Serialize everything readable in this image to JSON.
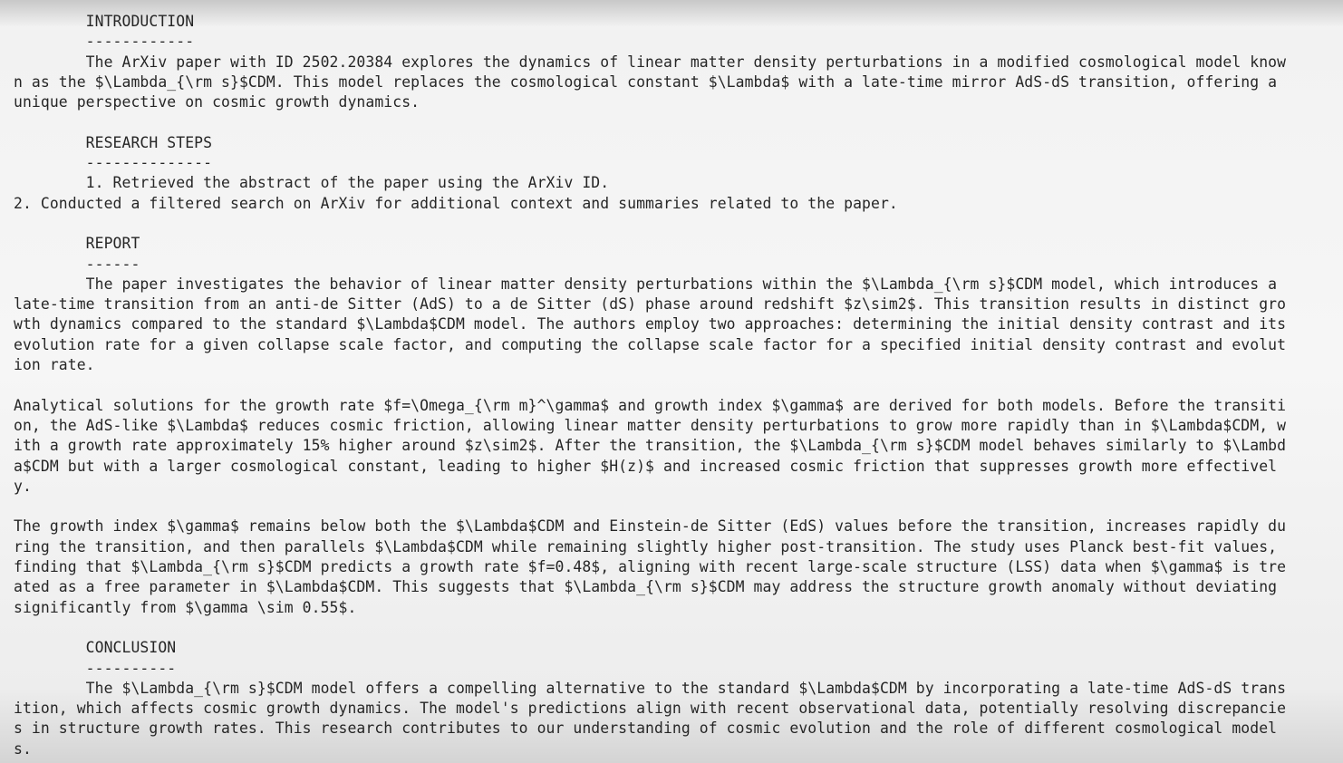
{
  "document": {
    "lines": [
      "        INTRODUCTION",
      "        ------------",
      "        The ArXiv paper with ID 2502.20384 explores the dynamics of linear matter density perturbations in a modified cosmological model know",
      "n as the $\\Lambda_{\\rm s}$CDM. This model replaces the cosmological constant $\\Lambda$ with a late-time mirror AdS-dS transition, offering a",
      "unique perspective on cosmic growth dynamics.",
      "",
      "        RESEARCH STEPS",
      "        --------------",
      "        1. Retrieved the abstract of the paper using the ArXiv ID.",
      "2. Conducted a filtered search on ArXiv for additional context and summaries related to the paper.",
      "",
      "        REPORT",
      "        ------",
      "        The paper investigates the behavior of linear matter density perturbations within the $\\Lambda_{\\rm s}$CDM model, which introduces a",
      "late-time transition from an anti-de Sitter (AdS) to a de Sitter (dS) phase around redshift $z\\sim2$. This transition results in distinct gro",
      "wth dynamics compared to the standard $\\Lambda$CDM model. The authors employ two approaches: determining the initial density contrast and its",
      "evolution rate for a given collapse scale factor, and computing the collapse scale factor for a specified initial density contrast and evolut",
      "ion rate.",
      "",
      "Analytical solutions for the growth rate $f=\\Omega_{\\rm m}^\\gamma$ and growth index $\\gamma$ are derived for both models. Before the transiti",
      "on, the AdS-like $\\Lambda$ reduces cosmic friction, allowing linear matter density perturbations to grow more rapidly than in $\\Lambda$CDM, w",
      "ith a growth rate approximately 15% higher around $z\\sim2$. After the transition, the $\\Lambda_{\\rm s}$CDM model behaves similarly to $\\Lambd",
      "a$CDM but with a larger cosmological constant, leading to higher $H(z)$ and increased cosmic friction that suppresses growth more effectivel",
      "y.",
      "",
      "The growth index $\\gamma$ remains below both the $\\Lambda$CDM and Einstein-de Sitter (EdS) values before the transition, increases rapidly du",
      "ring the transition, and then parallels $\\Lambda$CDM while remaining slightly higher post-transition. The study uses Planck best-fit values,",
      "finding that $\\Lambda_{\\rm s}$CDM predicts a growth rate $f=0.48$, aligning with recent large-scale structure (LSS) data when $\\gamma$ is tre",
      "ated as a free parameter in $\\Lambda$CDM. This suggests that $\\Lambda_{\\rm s}$CDM may address the structure growth anomaly without deviating",
      "significantly from $\\gamma \\sim 0.55$.",
      "",
      "        CONCLUSION",
      "        ----------",
      "        The $\\Lambda_{\\rm s}$CDM model offers a compelling alternative to the standard $\\Lambda$CDM by incorporating a late-time AdS-dS trans",
      "ition, which affects cosmic growth dynamics. The model's predictions align with recent observational data, potentially resolving discrepancie",
      "s in structure growth rates. This research contributes to our understanding of cosmic evolution and the role of different cosmological model",
      "s."
    ]
  }
}
